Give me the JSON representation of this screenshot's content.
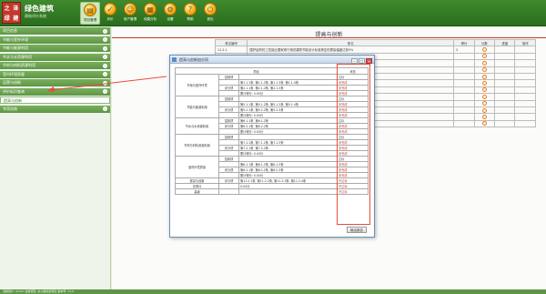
{
  "app": {
    "logo_chars": [
      "之",
      "泽",
      "绿",
      "建"
    ],
    "name": "绿色建筑",
    "subtitle": "建筑评价系统"
  },
  "toolbar": {
    "items": [
      {
        "label": "项目管理",
        "icon": "folder-icon",
        "active": true
      },
      {
        "label": "评价",
        "icon": "check-icon",
        "active": false
      },
      {
        "label": "用户管理",
        "icon": "user-icon",
        "active": false
      },
      {
        "label": "待建分析",
        "icon": "chart-icon",
        "active": false
      },
      {
        "label": "设置",
        "icon": "gear-icon",
        "active": false
      },
      {
        "label": "帮助",
        "icon": "help-icon",
        "active": false
      },
      {
        "label": "退出",
        "icon": "power-icon",
        "active": false
      }
    ]
  },
  "sidebar": {
    "items": [
      {
        "label": "项目信息",
        "selected": false
      },
      {
        "label": "节能与室外环境",
        "selected": false
      },
      {
        "label": "节能与能源利用",
        "selected": false
      },
      {
        "label": "节水与水资源利用",
        "selected": false
      },
      {
        "label": "节材与材料资源利用",
        "selected": false
      },
      {
        "label": "室内环境质量",
        "selected": false
      },
      {
        "label": "运营与创新",
        "selected": false
      },
      {
        "label": "评价标识查询",
        "selected": false
      },
      {
        "label": "提高与创新",
        "selected": true
      },
      {
        "label": "专项总结",
        "selected": false
      }
    ]
  },
  "main": {
    "title": "提高与创新",
    "table": {
      "headers": [
        "条文编号",
        "条文",
        "得分",
        "分数",
        "进度",
        "操作"
      ],
      "rows": [
        {
          "code": "11.2.1",
          "text": "围护结构热工性能比国家现行相关建筑节能设计标准规定的提高幅度达到5%",
          "score": "2"
        },
        {
          "code": "",
          "text": "供暖空调全年计算负荷降低幅度达到5%",
          "score": ""
        },
        {
          "code": "",
          "text": "供暖空调系统的冷、热源机组能效均优于现行国家标准",
          "score": ""
        },
        {
          "code": "",
          "text": "卫生器具的用水效率均达到国家现行有关卫生器具用水等级标准规定的1级",
          "score": ""
        },
        {
          "code": "",
          "text": "采用资源消耗少和环境影响小的建筑结构",
          "score": ""
        },
        {
          "code": "",
          "text": "对主要功能房间采取有效的空气处理措施",
          "score": ""
        },
        {
          "code": "",
          "text": "室内空气中的氨、甲醛、苯、总挥发性有机物等污染物浓度",
          "score": ""
        },
        {
          "code": "",
          "text": "建筑方案充分考虑建筑所在地域的气候、环境、资源",
          "score": ""
        },
        {
          "code": "",
          "text": "合理选用废弃场地进行建设",
          "score": ""
        },
        {
          "code": "",
          "text": "应用建筑信息模型(BIM)技术",
          "score": ""
        },
        {
          "code": "",
          "text": "进行建筑碳排放计算分析",
          "score": ""
        },
        {
          "code": "",
          "text": "采取节约能源资源、保护生态环境的创新",
          "score": ""
        }
      ]
    }
  },
  "dialog": {
    "title": "提高与创新加分项",
    "header_col": "项目",
    "header_status": "状态",
    "groups": [
      {
        "name": "节地与室外环境",
        "rows": [
          {
            "type": "控制项",
            "content": "",
            "status": "达标"
          },
          {
            "type": "",
            "content": "第1.1.1条, 第1.1.2条, 第1.1.3条, 第1.1.4条",
            "status": "未完成"
          },
          {
            "type": "评分项",
            "content": "第2.1.1条, 第2.1.2条, 第2.1.3条",
            "status": "未完成"
          },
          {
            "type": "",
            "content": "累计得分: 0.00分",
            "status": "未完成"
          }
        ]
      },
      {
        "name": "节能与能源利用",
        "rows": [
          {
            "type": "控制项",
            "content": "",
            "status": "达标"
          },
          {
            "type": "",
            "content": "第5.1.1条, 第5.1.2条, 第5.1.3条, 第5.1.4条",
            "status": "未完成"
          },
          {
            "type": "评分项",
            "content": "第5.2.1条, 第5.2.2条, 第5.2.3条",
            "status": "未完成"
          },
          {
            "type": "",
            "content": "累计得分: 0.00分",
            "status": "未完成"
          }
        ]
      },
      {
        "name": "节水与水资源利用",
        "rows": [
          {
            "type": "控制项",
            "content": "第6.1.1条, 第6.1.2条",
            "status": "达标"
          },
          {
            "type": "评分项",
            "content": "第6.2.1条, 第6.2.2条",
            "status": "未完成"
          },
          {
            "type": "",
            "content": "累计得分: 0.00分",
            "status": "未完成"
          }
        ]
      },
      {
        "name": "节材与材料资源利用",
        "rows": [
          {
            "type": "控制项",
            "content": "",
            "status": "达标"
          },
          {
            "type": "",
            "content": "第7.1.1条, 第7.1.2条, 第7.1.3条",
            "status": "未完成"
          },
          {
            "type": "评分项",
            "content": "第7.2.1条, 第7.2.2条",
            "status": "未完成"
          },
          {
            "type": "",
            "content": "累计得分: 0.00分",
            "status": "未完成"
          }
        ]
      },
      {
        "name": "室内环境质量",
        "rows": [
          {
            "type": "控制项",
            "content": "",
            "status": "达标"
          },
          {
            "type": "",
            "content": "第8.1.1条, 第8.1.2条, 第8.1.3条",
            "status": "未完成"
          },
          {
            "type": "评分项",
            "content": "第8.2.1条, 第8.2.2条, 第8.2.3条",
            "status": "未完成"
          },
          {
            "type": "",
            "content": "累计得分: 0.00分",
            "status": "未完成"
          }
        ]
      }
    ],
    "footer_rows": [
      {
        "name": "提高与创新",
        "type": "评分项",
        "content": "第11.2.1条, 第11.2.2条, 第11.2.3条, 第11.2.4条",
        "status": "不达标"
      },
      {
        "name": "总得分",
        "type": "",
        "content": "0.00分",
        "status": "不达标"
      },
      {
        "name": "星级",
        "type": "",
        "content": "",
        "status": "不达标"
      }
    ],
    "button": "输出报告"
  },
  "statusbar": {
    "text": "当前用户: admin  当前项目: 办公楼综合项目  版本号: V1.0"
  },
  "colors": {
    "primary": "#4a8f35",
    "alert": "#c0392b"
  }
}
